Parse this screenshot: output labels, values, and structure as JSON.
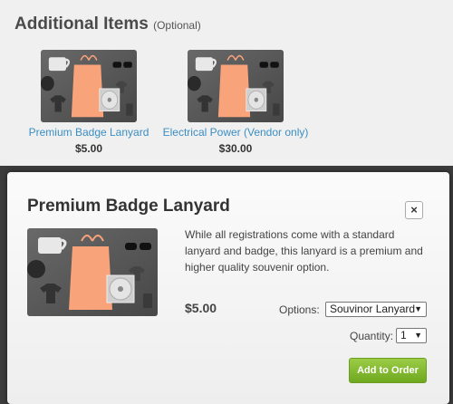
{
  "section": {
    "title": "Additional Items",
    "optional": "(Optional)"
  },
  "items": [
    {
      "name": "Premium Badge Lanyard",
      "price": "$5.00"
    },
    {
      "name": "Electrical Power (Vendor only)",
      "price": "$30.00"
    }
  ],
  "modal": {
    "title": "Premium Badge Lanyard",
    "close_icon": "close-icon",
    "close_glyph": "×",
    "description": "While all registrations come with a standard lanyard and badge, this lanyard is a premium and higher quality souvenir option.",
    "price": "$5.00",
    "options_label": "Options:",
    "options_value": "Souvinor Lanyard",
    "quantity_label": "Quantity:",
    "quantity_value": "1",
    "add_button": "Add to Order"
  },
  "colors": {
    "link": "#3b8ec2",
    "button": "#7db432",
    "bag": "#f9a37a"
  }
}
